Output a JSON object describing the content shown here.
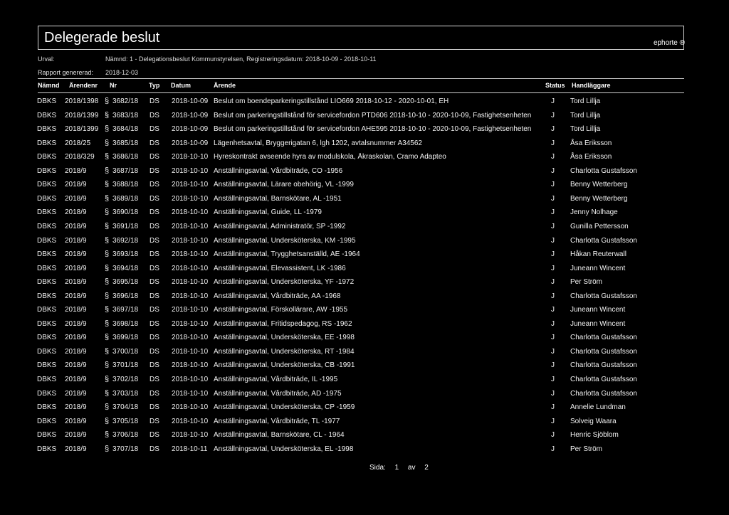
{
  "report": {
    "title": "Delegerade beslut",
    "brand": "ephorte ®",
    "urval_label": "Urval:",
    "urval_value": "Nämnd: 1 - Delegationsbeslut Kommunstyrelsen, Registreringsdatum: 2018-10-09 - 2018-10-11",
    "generated_label": "Rapport genererad:",
    "generated_value": "2018-12-03"
  },
  "columns": {
    "namnd": "Nämnd",
    "arendenr": "Ärendenr",
    "nr": "Nr",
    "typ": "Typ",
    "datum": "Datum",
    "arende": "Ärende",
    "status": "Status",
    "handlaggare": "Handläggare"
  },
  "section_symbol": "§",
  "rows": [
    {
      "namnd": "DBKS",
      "arendenr": "2018/1398",
      "nr": "3682/18",
      "typ": "DS",
      "datum": "2018-10-09",
      "arende": "Beslut om boendeparkeringstillstånd LIO669 2018-10-12 - 2020-10-01, EH",
      "status": "J",
      "handlaggare": "Tord Lillja"
    },
    {
      "namnd": "DBKS",
      "arendenr": "2018/1399",
      "nr": "3683/18",
      "typ": "DS",
      "datum": "2018-10-09",
      "arende": "Beslut om parkeringstillstånd för servicefordon PTD606 2018-10-10 - 2020-10-09, Fastighetsenheten",
      "status": "J",
      "handlaggare": "Tord Lillja"
    },
    {
      "namnd": "DBKS",
      "arendenr": "2018/1399",
      "nr": "3684/18",
      "typ": "DS",
      "datum": "2018-10-09",
      "arende": "Beslut om parkeringstillstånd för servicefordon AHE595 2018-10-10 - 2020-10-09, Fastighetsenheten",
      "status": "J",
      "handlaggare": "Tord Lillja"
    },
    {
      "namnd": "DBKS",
      "arendenr": "2018/25",
      "nr": "3685/18",
      "typ": "DS",
      "datum": "2018-10-09",
      "arende": "Lägenhetsavtal, Bryggerigatan 6, lgh 1202, avtalsnummer A34562",
      "status": "J",
      "handlaggare": "Åsa Eriksson"
    },
    {
      "namnd": "DBKS",
      "arendenr": "2018/329",
      "nr": "3686/18",
      "typ": "DS",
      "datum": "2018-10-10",
      "arende": "Hyreskontrakt avseende hyra av modulskola, Åkraskolan, Cramo Adapteo",
      "status": "J",
      "handlaggare": "Åsa Eriksson"
    },
    {
      "namnd": "DBKS",
      "arendenr": "2018/9",
      "nr": "3687/18",
      "typ": "DS",
      "datum": "2018-10-10",
      "arende": "Anställningsavtal, Vårdbiträde, CO -1956",
      "status": "J",
      "handlaggare": "Charlotta Gustafsson"
    },
    {
      "namnd": "DBKS",
      "arendenr": "2018/9",
      "nr": "3688/18",
      "typ": "DS",
      "datum": "2018-10-10",
      "arende": "Anställningsavtal, Lärare obehörig, VL -1999",
      "status": "J",
      "handlaggare": "Benny Wetterberg"
    },
    {
      "namnd": "DBKS",
      "arendenr": "2018/9",
      "nr": "3689/18",
      "typ": "DS",
      "datum": "2018-10-10",
      "arende": "Anställningsavtal, Barnskötare, AL -1951",
      "status": "J",
      "handlaggare": "Benny Wetterberg"
    },
    {
      "namnd": "DBKS",
      "arendenr": "2018/9",
      "nr": "3690/18",
      "typ": "DS",
      "datum": "2018-10-10",
      "arende": "Anställningsavtal, Guide, LL -1979",
      "status": "J",
      "handlaggare": "Jenny Nolhage"
    },
    {
      "namnd": "DBKS",
      "arendenr": "2018/9",
      "nr": "3691/18",
      "typ": "DS",
      "datum": "2018-10-10",
      "arende": "Anställningsavtal, Administratör, SP -1992",
      "status": "J",
      "handlaggare": "Gunilla Pettersson"
    },
    {
      "namnd": "DBKS",
      "arendenr": "2018/9",
      "nr": "3692/18",
      "typ": "DS",
      "datum": "2018-10-10",
      "arende": "Anställningsavtal, Undersköterska, KM -1995",
      "status": "J",
      "handlaggare": "Charlotta Gustafsson"
    },
    {
      "namnd": "DBKS",
      "arendenr": "2018/9",
      "nr": "3693/18",
      "typ": "DS",
      "datum": "2018-10-10",
      "arende": "Anställningsavtal, Trygghetsanställd, AE -1964",
      "status": "J",
      "handlaggare": "Håkan Reuterwall"
    },
    {
      "namnd": "DBKS",
      "arendenr": "2018/9",
      "nr": "3694/18",
      "typ": "DS",
      "datum": "2018-10-10",
      "arende": "Anställningsavtal, Elevassistent, LK -1986",
      "status": "J",
      "handlaggare": "Juneann Wincent"
    },
    {
      "namnd": "DBKS",
      "arendenr": "2018/9",
      "nr": "3695/18",
      "typ": "DS",
      "datum": "2018-10-10",
      "arende": "Anställningsavtal, Undersköterska, YF -1972",
      "status": "J",
      "handlaggare": "Per Ström"
    },
    {
      "namnd": "DBKS",
      "arendenr": "2018/9",
      "nr": "3696/18",
      "typ": "DS",
      "datum": "2018-10-10",
      "arende": "Anställningsavtal, Vårdbiträde, AA -1968",
      "status": "J",
      "handlaggare": "Charlotta Gustafsson"
    },
    {
      "namnd": "DBKS",
      "arendenr": "2018/9",
      "nr": "3697/18",
      "typ": "DS",
      "datum": "2018-10-10",
      "arende": "Anställningsavtal, Förskollärare, AW -1955",
      "status": "J",
      "handlaggare": "Juneann Wincent"
    },
    {
      "namnd": "DBKS",
      "arendenr": "2018/9",
      "nr": "3698/18",
      "typ": "DS",
      "datum": "2018-10-10",
      "arende": "Anställningsavtal, Fritidspedagog, RS -1962",
      "status": "J",
      "handlaggare": "Juneann Wincent"
    },
    {
      "namnd": "DBKS",
      "arendenr": "2018/9",
      "nr": "3699/18",
      "typ": "DS",
      "datum": "2018-10-10",
      "arende": "Anställningsavtal, Undersköterska, EE -1998",
      "status": "J",
      "handlaggare": "Charlotta Gustafsson"
    },
    {
      "namnd": "DBKS",
      "arendenr": "2018/9",
      "nr": "3700/18",
      "typ": "DS",
      "datum": "2018-10-10",
      "arende": "Anställningsavtal, Undersköterska, RT -1984",
      "status": "J",
      "handlaggare": "Charlotta Gustafsson"
    },
    {
      "namnd": "DBKS",
      "arendenr": "2018/9",
      "nr": "3701/18",
      "typ": "DS",
      "datum": "2018-10-10",
      "arende": "Anställningsavtal, Undersköterska, CB -1991",
      "status": "J",
      "handlaggare": "Charlotta Gustafsson"
    },
    {
      "namnd": "DBKS",
      "arendenr": "2018/9",
      "nr": "3702/18",
      "typ": "DS",
      "datum": "2018-10-10",
      "arende": "Anställningsavtal, Vårdbiträde, IL -1995",
      "status": "J",
      "handlaggare": "Charlotta Gustafsson"
    },
    {
      "namnd": "DBKS",
      "arendenr": "2018/9",
      "nr": "3703/18",
      "typ": "DS",
      "datum": "2018-10-10",
      "arende": "Anställningsavtal, Vårdbiträde, AD -1975",
      "status": "J",
      "handlaggare": "Charlotta Gustafsson"
    },
    {
      "namnd": "DBKS",
      "arendenr": "2018/9",
      "nr": "3704/18",
      "typ": "DS",
      "datum": "2018-10-10",
      "arende": "Anställningsavtal, Undersköterska, CP -1959",
      "status": "J",
      "handlaggare": "Annelie Lundman"
    },
    {
      "namnd": "DBKS",
      "arendenr": "2018/9",
      "nr": "3705/18",
      "typ": "DS",
      "datum": "2018-10-10",
      "arende": "Anställningsavtal, Vårdbiträde, TL -1977",
      "status": "J",
      "handlaggare": "Solveig Waara"
    },
    {
      "namnd": "DBKS",
      "arendenr": "2018/9",
      "nr": "3706/18",
      "typ": "DS",
      "datum": "2018-10-10",
      "arende": "Anställningsavtal, Barnskötare, CL - 1964",
      "status": "J",
      "handlaggare": "Henric Sjöblom"
    },
    {
      "namnd": "DBKS",
      "arendenr": "2018/9",
      "nr": "3707/18",
      "typ": "DS",
      "datum": "2018-10-11",
      "arende": "Anställningsavtal, Undersköterska, EL -1998",
      "status": "J",
      "handlaggare": "Per Ström"
    }
  ],
  "footer": {
    "page_label": "Sida:",
    "page_current": "1",
    "page_of": "av",
    "page_total": "2"
  }
}
